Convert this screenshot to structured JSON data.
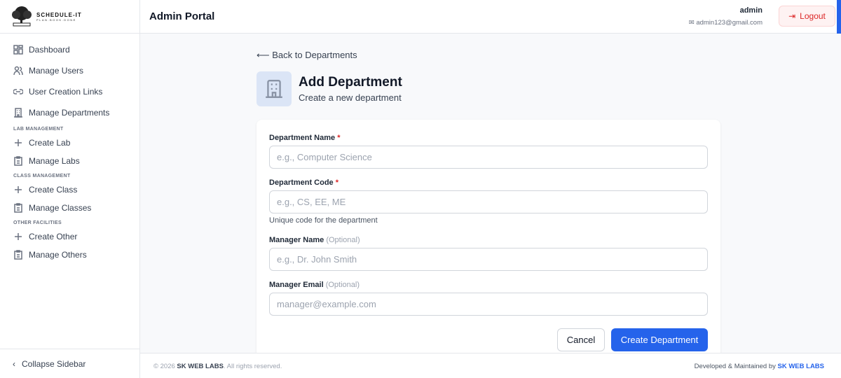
{
  "brand": {
    "name": "SCHEDULE-IT",
    "tagline": "PLAN.BOOK.DONE"
  },
  "sidebar": {
    "items": [
      {
        "label": "Dashboard",
        "icon": "grid-icon"
      },
      {
        "label": "Manage Users",
        "icon": "users-icon"
      },
      {
        "label": "User Creation Links",
        "icon": "link-icon"
      },
      {
        "label": "Manage Departments",
        "icon": "building-icon"
      }
    ],
    "sections": [
      {
        "title": "LAB MANAGEMENT",
        "items": [
          {
            "label": "Create Lab",
            "icon": "plus-icon"
          },
          {
            "label": "Manage Labs",
            "icon": "clipboard-icon"
          }
        ]
      },
      {
        "title": "CLASS MANAGEMENT",
        "items": [
          {
            "label": "Create Class",
            "icon": "plus-icon"
          },
          {
            "label": "Manage Classes",
            "icon": "clipboard-icon"
          }
        ]
      },
      {
        "title": "OTHER FACILITIES",
        "items": [
          {
            "label": "Create Other",
            "icon": "plus-icon"
          },
          {
            "label": "Manage Others",
            "icon": "clipboard-icon"
          }
        ]
      }
    ],
    "collapse": "Collapse Sidebar"
  },
  "header": {
    "title": "Admin Portal",
    "user": "admin",
    "email": "admin123@gmail.com",
    "logout": "Logout"
  },
  "page": {
    "back": "Back to Departments",
    "title": "Add Department",
    "subtitle": "Create a new department"
  },
  "form": {
    "name_label": "Department Name",
    "name_placeholder": "e.g., Computer Science",
    "code_label": "Department Code",
    "code_placeholder": "e.g., CS, EE, ME",
    "code_hint": "Unique code for the department",
    "manager_label": "Manager Name",
    "manager_placeholder": "e.g., Dr. John Smith",
    "email_label": "Manager Email",
    "email_placeholder": "manager@example.com",
    "required": "*",
    "optional": "(Optional)",
    "cancel": "Cancel",
    "submit": "Create Department"
  },
  "footer": {
    "copy": "© 2026",
    "company": "SK WEB LABS",
    "rights": ". All rights reserved.",
    "dev": "Developed & Maintained by",
    "dev_company": "SK WEB LABS"
  }
}
